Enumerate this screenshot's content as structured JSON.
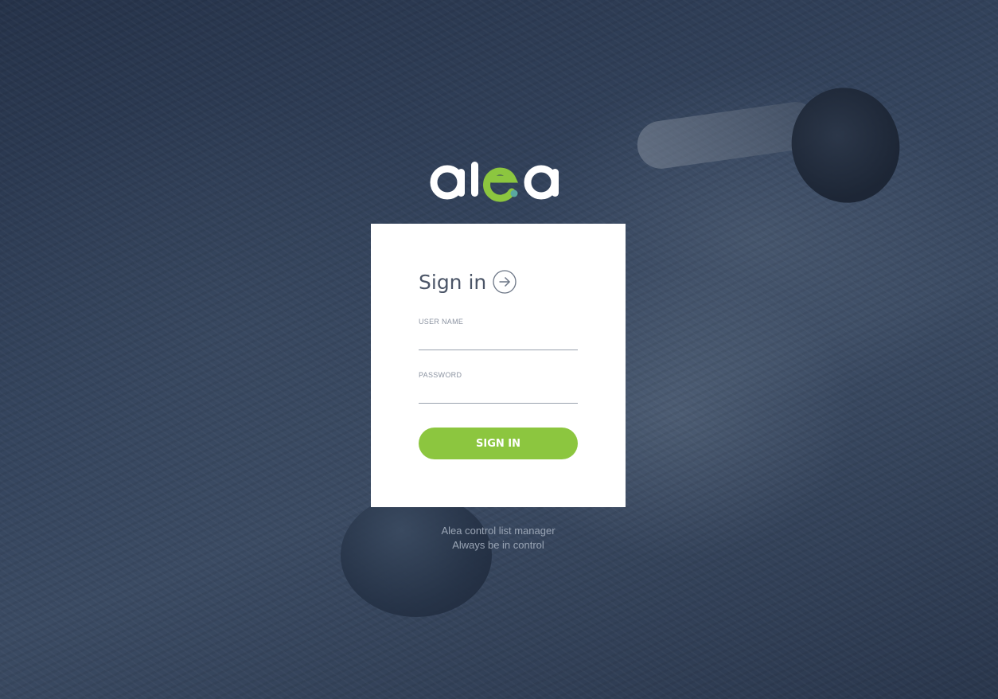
{
  "brand": {
    "logo_text": "alea",
    "logo_color_primary": "#ffffff",
    "logo_color_accent": "#8cc63f"
  },
  "signin": {
    "title": "Sign in",
    "title_icon": "arrow-right-circle-icon",
    "username_label": "USER NAME",
    "username_value": "",
    "password_label": "PASSWORD",
    "password_value": "",
    "button_label": "SIGN IN",
    "button_color": "#8cc63f"
  },
  "footer": {
    "line1": "Alea control list manager",
    "line2": "Always be in control"
  }
}
